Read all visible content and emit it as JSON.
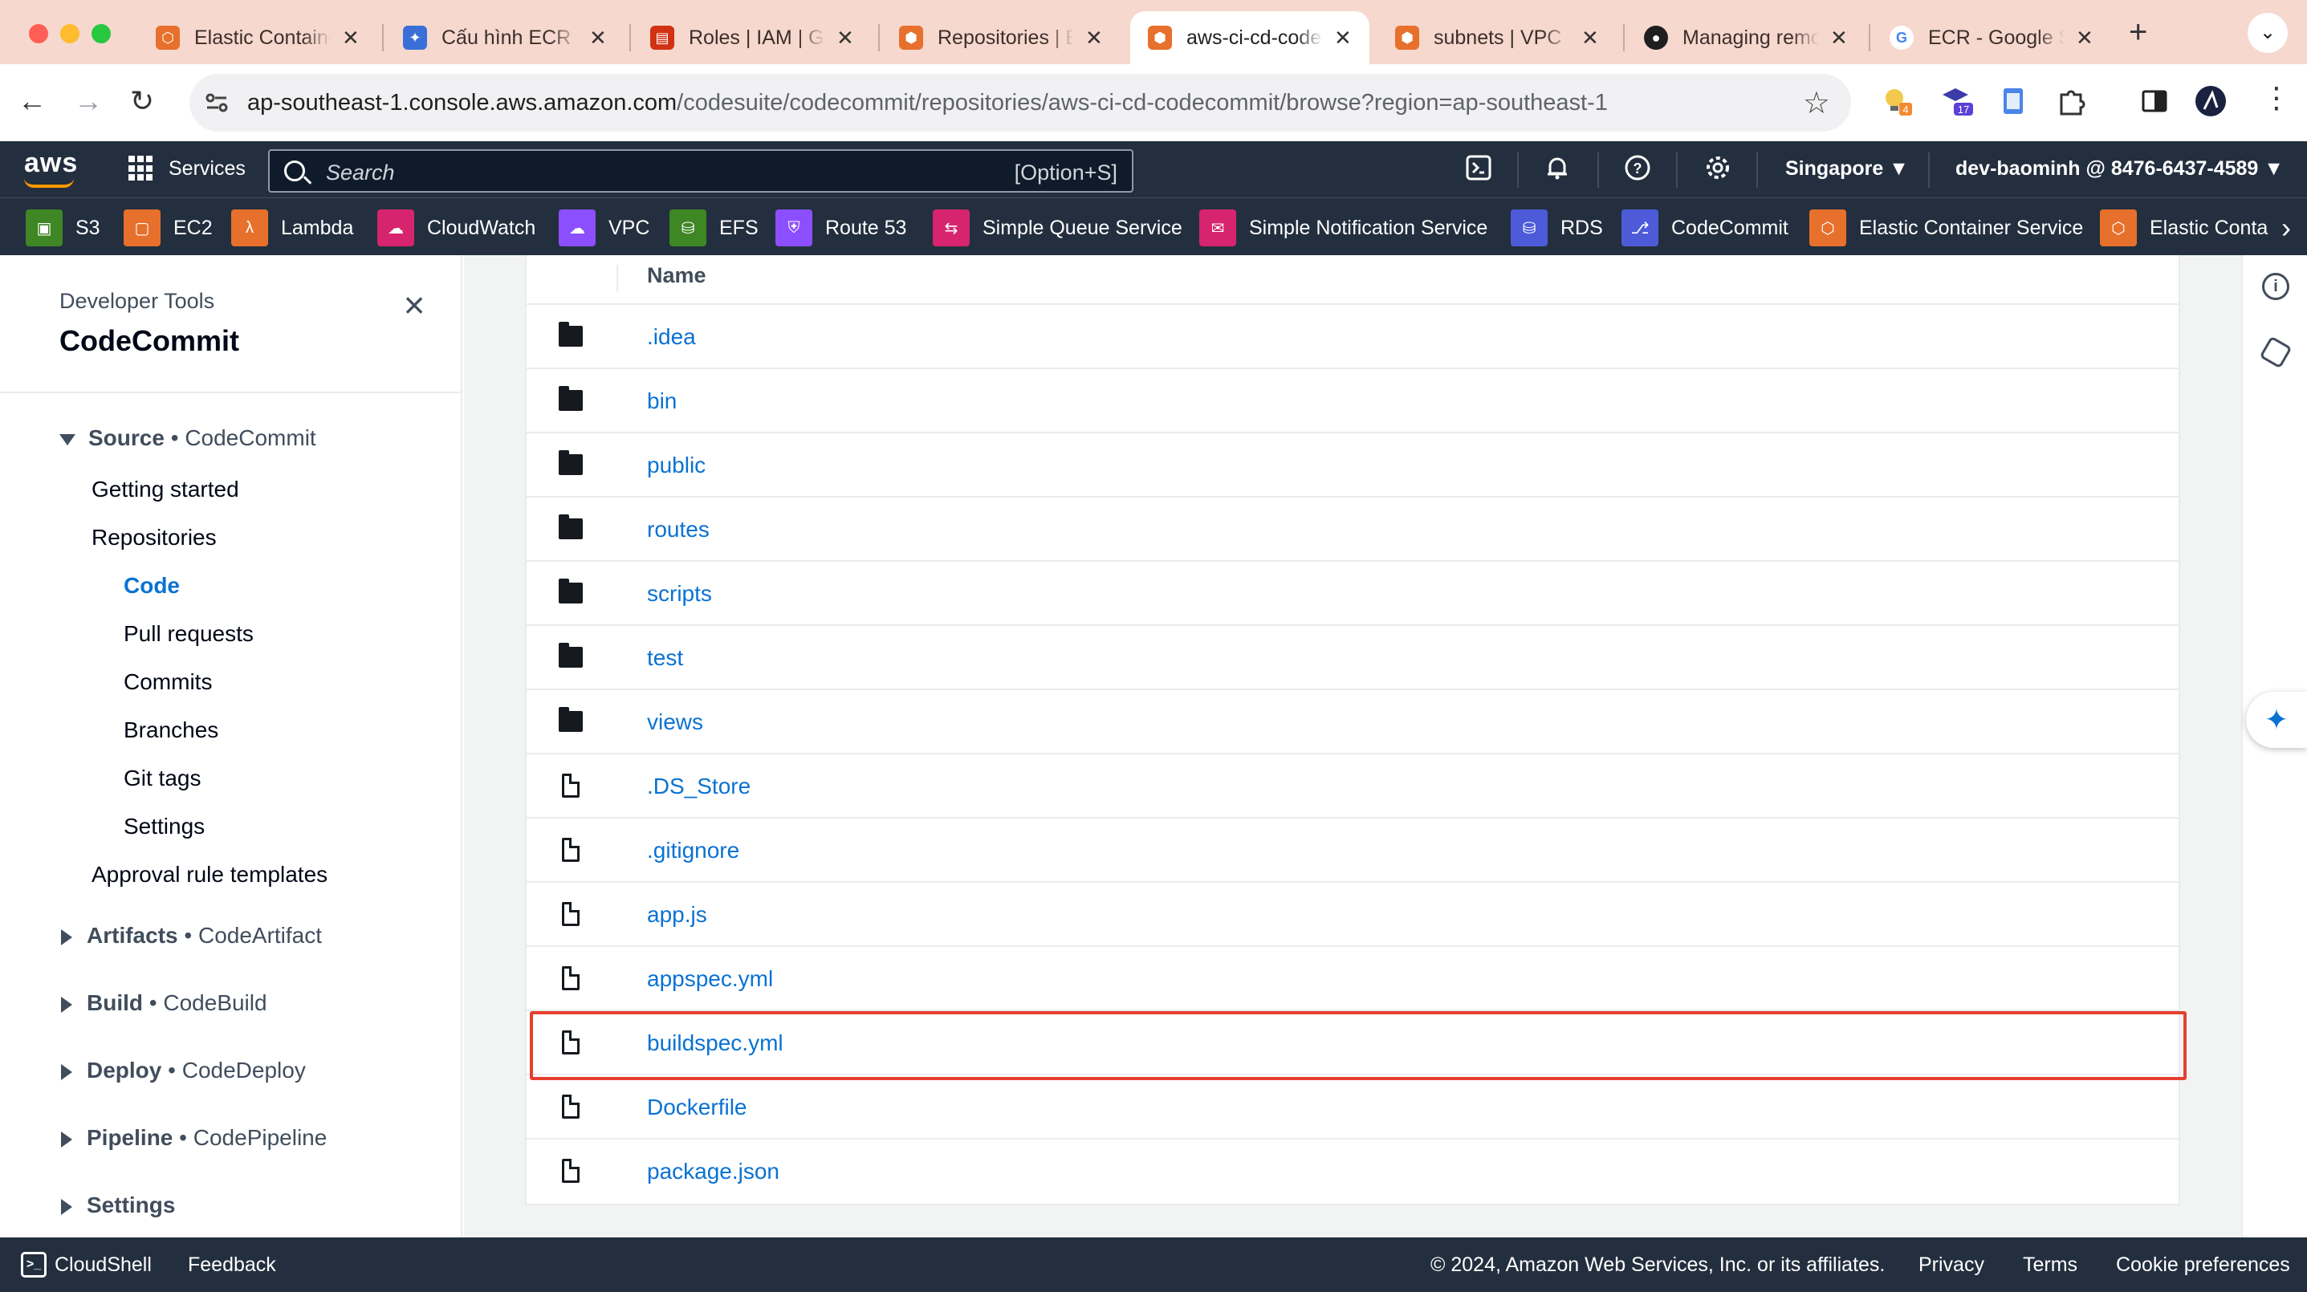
{
  "browser": {
    "tabs": [
      {
        "title": "Elastic Container Service",
        "favicon_color": "#e7702c",
        "favicon_glyph": "⬡"
      },
      {
        "title": "Cấu hình ECR",
        "favicon_color": "#3b6fd8",
        "favicon_glyph": "✦"
      },
      {
        "title": "Roles | IAM | Global",
        "favicon_color": "#d13212",
        "favicon_glyph": "▤"
      },
      {
        "title": "Repositories | ECR",
        "favicon_color": "#e7702c",
        "favicon_glyph": "⬢"
      },
      {
        "title": "aws-ci-cd-codecommit",
        "favicon_color": "#e7702c",
        "favicon_glyph": "⬢",
        "active": true
      },
      {
        "title": "subnets | VPC",
        "favicon_color": "#e7702c",
        "favicon_glyph": "⬢"
      },
      {
        "title": "Managing remote",
        "favicon_color": "#1f1f1f",
        "favicon_glyph": "●"
      },
      {
        "title": "ECR - Google Search",
        "favicon_color": "#ffffff",
        "favicon_glyph": "G"
      }
    ],
    "new_tab_label": "+",
    "url_host": "ap-southeast-1.console.aws.amazon.com",
    "url_path": "/codesuite/codecommit/repositories/aws-ci-cd-codecommit/browse?region=ap-southeast-1",
    "extension_badges": [
      "4",
      "17"
    ]
  },
  "aws_header": {
    "logo": "aws",
    "services_label": "Services",
    "search_placeholder": "Search",
    "search_shortcut": "[Option+S]",
    "region": "Singapore ▼",
    "account": "dev-baominh @ 8476-6437-4589 ▼"
  },
  "favorites": [
    {
      "label": "S3",
      "color": "#3f8624"
    },
    {
      "label": "EC2",
      "color": "#e7702c"
    },
    {
      "label": "Lambda",
      "color": "#e7702c"
    },
    {
      "label": "CloudWatch",
      "color": "#d6246e"
    },
    {
      "label": "VPC",
      "color": "#8c4fff"
    },
    {
      "label": "EFS",
      "color": "#3f8624"
    },
    {
      "label": "Route 53",
      "color": "#8c4fff"
    },
    {
      "label": "Simple Queue Service",
      "color": "#d6246e"
    },
    {
      "label": "Simple Notification Service",
      "color": "#d6246e"
    },
    {
      "label": "RDS",
      "color": "#4d5bd9"
    },
    {
      "label": "CodeCommit",
      "color": "#4d5bd9"
    },
    {
      "label": "Elastic Container Service",
      "color": "#e7702c"
    },
    {
      "label": "Elastic Conta",
      "color": "#e7702c"
    }
  ],
  "sidebar": {
    "subtitle": "Developer Tools",
    "title": "CodeCommit",
    "source": {
      "group": "Source",
      "sep": " • ",
      "service": "CodeCommit"
    },
    "items": [
      {
        "label": "Getting started"
      },
      {
        "label": "Repositories"
      },
      {
        "label": "Code",
        "active": true
      },
      {
        "label": "Pull requests"
      },
      {
        "label": "Commits"
      },
      {
        "label": "Branches"
      },
      {
        "label": "Git tags"
      },
      {
        "label": "Settings"
      },
      {
        "label": "Approval rule templates"
      }
    ],
    "sections": [
      {
        "group": "Artifacts",
        "sep": " • ",
        "service": "CodeArtifact"
      },
      {
        "group": "Build",
        "sep": " • ",
        "service": "CodeBuild"
      },
      {
        "group": "Deploy",
        "sep": " • ",
        "service": "CodeDeploy"
      },
      {
        "group": "Pipeline",
        "sep": " • ",
        "service": "CodePipeline"
      },
      {
        "group": "Settings",
        "sep": "",
        "service": ""
      }
    ]
  },
  "files": {
    "header_name": "Name",
    "rows": [
      {
        "name": ".idea",
        "type": "folder"
      },
      {
        "name": "bin",
        "type": "folder"
      },
      {
        "name": "public",
        "type": "folder"
      },
      {
        "name": "routes",
        "type": "folder"
      },
      {
        "name": "scripts",
        "type": "folder"
      },
      {
        "name": "test",
        "type": "folder"
      },
      {
        "name": "views",
        "type": "folder"
      },
      {
        "name": ".DS_Store",
        "type": "file"
      },
      {
        "name": ".gitignore",
        "type": "file"
      },
      {
        "name": "app.js",
        "type": "file"
      },
      {
        "name": "appspec.yml",
        "type": "file"
      },
      {
        "name": "buildspec.yml",
        "type": "file",
        "highlighted": true
      },
      {
        "name": "Dockerfile",
        "type": "file"
      },
      {
        "name": "package.json",
        "type": "file"
      }
    ],
    "highlight_color": "#e5402f"
  },
  "footer": {
    "cloudshell": "CloudShell",
    "feedback": "Feedback",
    "copyright": "© 2024, Amazon Web Services, Inc. or its affiliates.",
    "privacy": "Privacy",
    "terms": "Terms",
    "cookies": "Cookie preferences"
  }
}
